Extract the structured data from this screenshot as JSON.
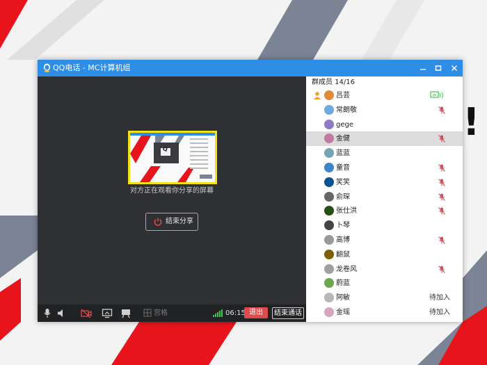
{
  "window": {
    "title": "QQ电话 - MC计算机组",
    "controls": [
      "minimize-icon",
      "maximize-icon",
      "close-icon"
    ]
  },
  "share": {
    "status_text": "对方正在观看你分享的屏幕",
    "end_share_label": "结束分享",
    "thumb_brand": "Q"
  },
  "toolbar": {
    "grid_label": "宫格",
    "time": "06:15",
    "exit_label": "退出",
    "end_call_label": "结束通话"
  },
  "members_panel": {
    "header": "群成员 14/16",
    "members": [
      {
        "name": "吕芸",
        "status": "",
        "muted": false,
        "owner": true,
        "sharing": true,
        "selected": false,
        "avatar_color": "#e28a3c"
      },
      {
        "name": "常朗敬",
        "status": "",
        "muted": true,
        "owner": false,
        "sharing": false,
        "selected": false,
        "avatar_color": "#6fa8dc"
      },
      {
        "name": "gege",
        "status": "",
        "muted": false,
        "owner": false,
        "sharing": false,
        "selected": false,
        "avatar_color": "#8e7cc3"
      },
      {
        "name": "金健",
        "status": "",
        "muted": true,
        "owner": false,
        "sharing": false,
        "selected": true,
        "avatar_color": "#c27ba0"
      },
      {
        "name": "蓝蓝",
        "status": "",
        "muted": false,
        "owner": false,
        "sharing": false,
        "selected": false,
        "avatar_color": "#76a5af"
      },
      {
        "name": "童音",
        "status": "",
        "muted": true,
        "owner": false,
        "sharing": false,
        "selected": false,
        "avatar_color": "#3d85c6"
      },
      {
        "name": "笑笑",
        "status": "",
        "muted": true,
        "owner": false,
        "sharing": false,
        "selected": false,
        "avatar_color": "#0b5394"
      },
      {
        "name": "俞琛",
        "status": "",
        "muted": true,
        "owner": false,
        "sharing": false,
        "selected": false,
        "avatar_color": "#666666"
      },
      {
        "name": "张仕洪",
        "status": "",
        "muted": true,
        "owner": false,
        "sharing": false,
        "selected": false,
        "avatar_color": "#274e13"
      },
      {
        "name": "卜琴",
        "status": "",
        "muted": false,
        "owner": false,
        "sharing": false,
        "selected": false,
        "avatar_color": "#444444"
      },
      {
        "name": "高博",
        "status": "",
        "muted": true,
        "owner": false,
        "sharing": false,
        "selected": false,
        "avatar_color": "#999999"
      },
      {
        "name": "翻鼠",
        "status": "",
        "muted": false,
        "owner": false,
        "sharing": false,
        "selected": false,
        "avatar_color": "#7f6000"
      },
      {
        "name": "龙卷风",
        "status": "",
        "muted": true,
        "owner": false,
        "sharing": false,
        "selected": false,
        "avatar_color": "#a0a0a0"
      },
      {
        "name": "蔚蓝",
        "status": "",
        "muted": false,
        "owner": false,
        "sharing": false,
        "selected": false,
        "avatar_color": "#6aa84f"
      },
      {
        "name": "阿敏",
        "status": "待加入",
        "muted": false,
        "owner": false,
        "sharing": false,
        "selected": false,
        "avatar_color": "#b7b7b7"
      },
      {
        "name": "金瑶",
        "status": "待加入",
        "muted": false,
        "owner": false,
        "sharing": false,
        "selected": false,
        "avatar_color": "#d5a6bd"
      }
    ]
  },
  "background_text": "!",
  "colors": {
    "titlebar": "#2e8ee6",
    "window_bg": "#2f3033",
    "exit": "#e04a4a",
    "share_border": "#f3e11c",
    "signal": "#3cc94b",
    "mute": "#d0505a"
  }
}
